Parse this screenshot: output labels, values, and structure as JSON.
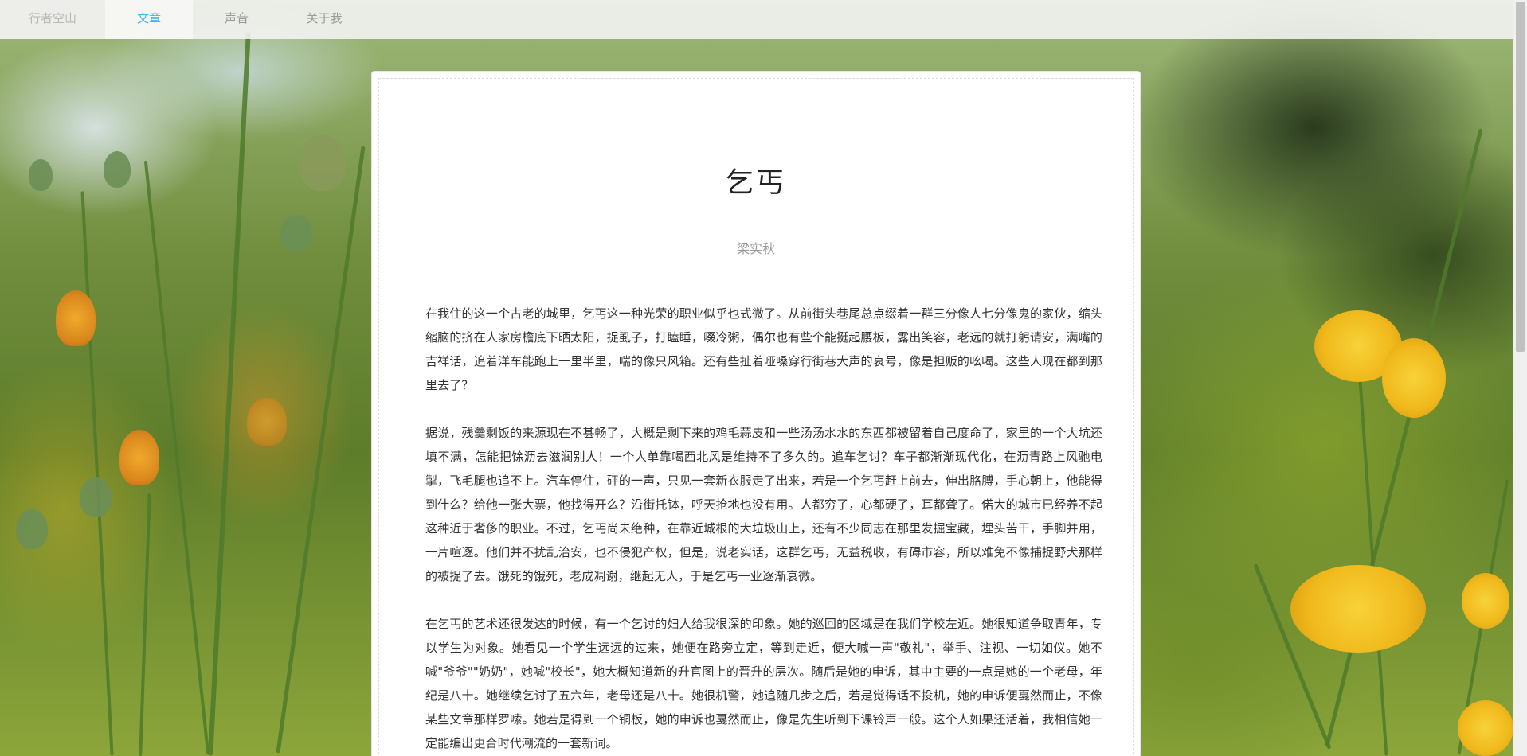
{
  "nav": {
    "brand": "行者空山",
    "items": [
      "文章",
      "声音",
      "关于我"
    ],
    "active_index": 0,
    "active_color": "#45b6e8"
  },
  "article": {
    "title": "乞丐",
    "author": "梁实秋",
    "paragraphs": [
      "在我住的这一个古老的城里，乞丐这一种光荣的职业似乎也式微了。从前街头巷尾总点缀着一群三分像人七分像鬼的家伙，缩头缩脑的挤在人家房檐底下晒太阳，捉虱子，打瞌睡，啜冷粥，偶尔也有些个能挺起腰板，露出笑容，老远的就打躬请安，满嘴的吉祥话，追着洋车能跑上一里半里，喘的像只风箱。还有些扯着哑嗓穿行街巷大声的哀号，像是担贩的吆喝。这些人现在都到那里去了？",
      "据说，残羹剩饭的来源现在不甚畅了，大概是剩下来的鸡毛蒜皮和一些汤汤水水的东西都被留着自己度命了，家里的一个大坑还填不满，怎能把馀沥去滋润别人！一个人单靠喝西北风是维持不了多久的。追车乞讨？车子都渐渐现代化，在沥青路上风驰电掣，飞毛腿也追不上。汽车停住，砰的一声，只见一套新衣服走了出来，若是一个乞丐赶上前去，伸出胳膊，手心朝上，他能得到什么？给他一张大票，他找得开么？沿街托钵，呼天抢地也没有用。人都穷了，心都硬了，耳都聋了。偌大的城市已经养不起这种近于奢侈的职业。不过，乞丐尚未绝种，在靠近城根的大垃圾山上，还有不少同志在那里发掘宝藏，埋头苦干，手脚并用，一片喧逐。他们并不扰乱治安，也不侵犯产权，但是，说老实话，这群乞丐，无益税收，有碍市容，所以难免不像捕捉野犬那样的被捉了去。饿死的饿死，老成凋谢，继起无人，于是乞丐一业逐渐衰微。",
      "在乞丐的艺术还很发达的时候，有一个乞讨的妇人给我很深的印象。她的巡回的区域是在我们学校左近。她很知道争取青年，专以学生为对象。她看见一个学生远远的过来，她便在路旁立定，等到走近，便大喊一声\"敬礼\"，举手、注视、一切如仪。她不喊\"爷爷\"\"奶奶\"，她喊\"校长\"，她大概知道新的升官图上的晋升的层次。随后是她的申诉，其中主要的一点是她的一个老母，年纪是八十。她继续乞讨了五六年，老母还是八十。她很机警，她追随几步之后，若是觉得话不投机，她的申诉便戛然而止，不像某些文章那样罗嗦。她若是得到一个铜板，她的申诉也戛然而止，像是先生听到下课铃声一般。这个人如果还活着，我相信她一定能编出更合时代潮流的一套新词。"
    ]
  }
}
